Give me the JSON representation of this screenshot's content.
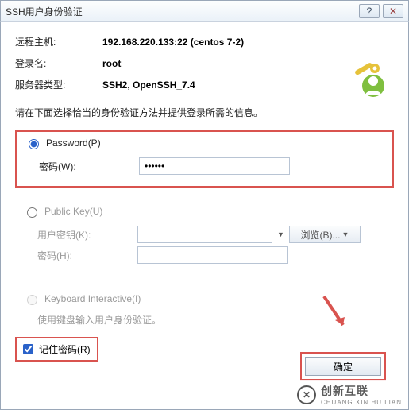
{
  "title": "SSH用户身份验证",
  "titlebar": {
    "help": "?",
    "close": "✕"
  },
  "info": {
    "remote_host_label": "远程主机:",
    "remote_host_value": "192.168.220.133:22 (centos 7-2)",
    "login_label": "登录名:",
    "login_value": "root",
    "server_type_label": "服务器类型:",
    "server_type_value": "SSH2, OpenSSH_7.4"
  },
  "instruction": "请在下面选择恰当的身份验证方法并提供登录所需的信息。",
  "password_section": {
    "radio_label": "Password(P)",
    "pw_label": "密码(W):",
    "pw_value": "••••••"
  },
  "publickey_section": {
    "radio_label": "Public Key(U)",
    "userkey_label": "用户密钥(K):",
    "userkey_value": "",
    "browse_label": "浏览(B)...",
    "passphrase_label": "密码(H):",
    "passphrase_value": ""
  },
  "keyboard_section": {
    "radio_label": "Keyboard Interactive(I)",
    "desc": "使用键盘输入用户身份验证。"
  },
  "remember_label": "记住密码(R)",
  "ok_label": "确定",
  "watermark": {
    "brand": "创新互联",
    "sub": "CHUANG XIN HU LIAN"
  }
}
